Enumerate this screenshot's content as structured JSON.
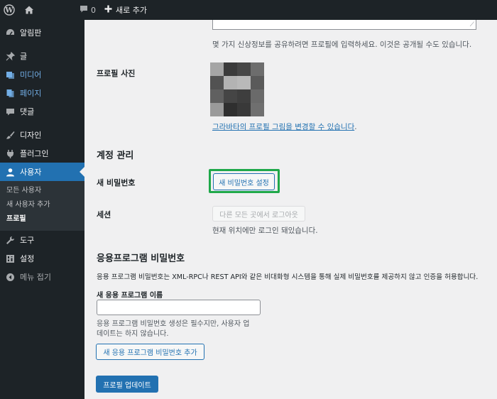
{
  "adminbar": {
    "comment_count": "0",
    "new_label": "새로 추가"
  },
  "sidebar": {
    "items": [
      {
        "label": "알림판",
        "icon": "dashboard-icon"
      },
      {
        "label": "글",
        "icon": "pin-icon"
      },
      {
        "label": "미디어",
        "icon": "media-icon"
      },
      {
        "label": "페이지",
        "icon": "page-icon"
      },
      {
        "label": "댓글",
        "icon": "comment-icon"
      },
      {
        "label": "디자인",
        "icon": "brush-icon"
      },
      {
        "label": "플러그인",
        "icon": "plugin-icon"
      },
      {
        "label": "사용자",
        "icon": "user-icon"
      },
      {
        "label": "도구",
        "icon": "wrench-icon"
      },
      {
        "label": "설정",
        "icon": "settings-icon"
      },
      {
        "label": "메뉴 접기",
        "icon": "collapse-icon"
      }
    ],
    "submenu": [
      "모든 사용자",
      "새 사용자 추가",
      "프로필"
    ]
  },
  "profile": {
    "bio_description": "몇 가지 신상정보를 공유하려면 프로필에 입력하세요. 이것은 공개될 수도 있습니다.",
    "photo_label": "프로필 사진",
    "gravatar_link": "그라바타의 프로필 그림을 변경할 수 있습니다",
    "gravatar_suffix": ".",
    "avatar_colors": [
      "#a5a5a5",
      "#3b3b3b",
      "#474747",
      "#6d6d6d",
      "#525252",
      "#b3b3b3",
      "#b9b9b9",
      "#5a5a5a",
      "#606060",
      "#454545",
      "#3e3e3e",
      "#6a6a6a",
      "#9a9a9a",
      "#2f2f2f",
      "#393939",
      "#6f6f6f"
    ]
  },
  "account": {
    "heading": "계정 관리",
    "new_password_label": "새 비밀번호",
    "set_password_button": "새 비밀번호 설정",
    "sessions_label": "세션",
    "logout_everywhere_button": "다른 모든 곳에서 로그아웃",
    "sessions_description": "현재 위치에만 로그인 돼있습니다."
  },
  "app_passwords": {
    "heading": "응용프로그램 비밀번호",
    "description": "응용 프로그램 비밀번호는 XML-RPC나 REST API와 같은 비대화형 시스템을 통해 실제 비밀번호를 제공하지 않고 인증을 허용합니다.",
    "name_label": "새 응용 프로그램 이름",
    "name_value": "",
    "help_line1": "응용 프로그램 비밀번호 생성은 필수지만, 사용자 업",
    "help_line2": "데이트는 하지 않습니다.",
    "add_button": "새 응용 프로그램 비밀번호 추가"
  },
  "update_button": "프로필 업데이트"
}
